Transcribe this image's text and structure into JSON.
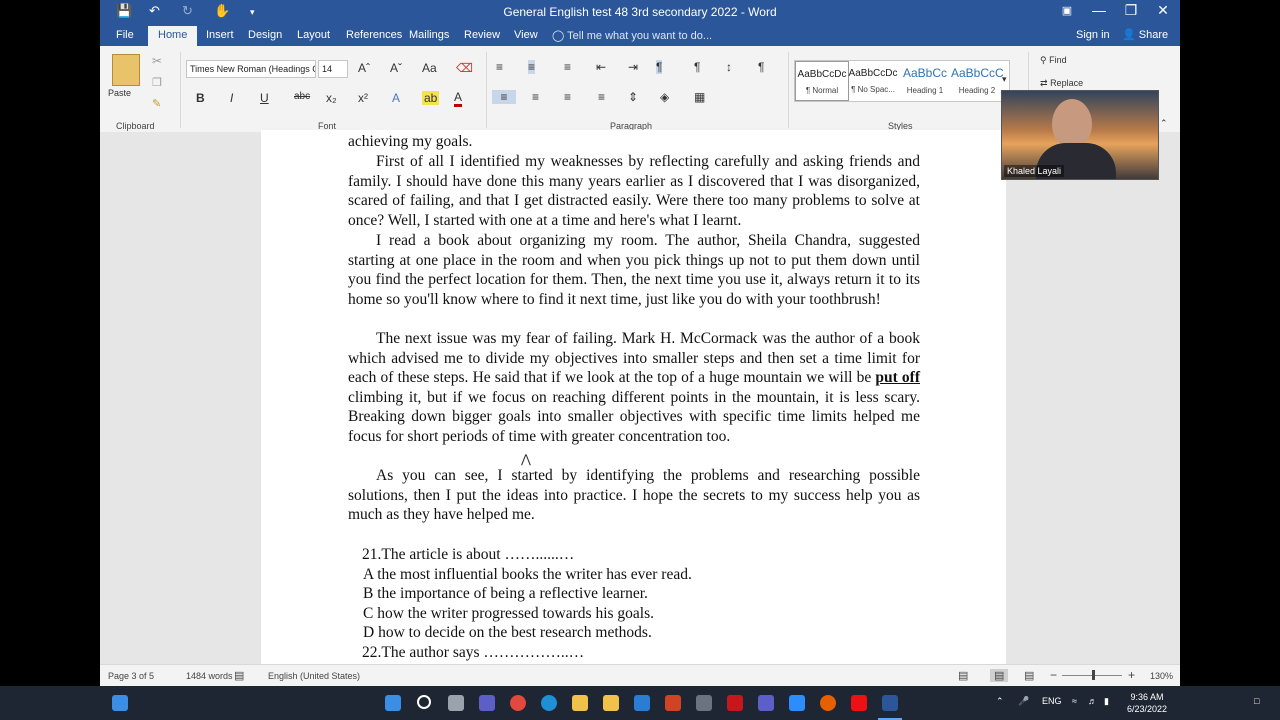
{
  "window": {
    "title": "General English test 48 3rd secondary 2022 - Word",
    "minimize": "—",
    "restore": "❐",
    "close": "✕",
    "ribbon_display_icon": "ribbon-display-icon"
  },
  "quick_access": {
    "save_icon": "save-icon",
    "undo_icon": "undo-icon",
    "redo_icon": "redo-icon",
    "touch_icon": "touch-mode-icon"
  },
  "tabs": [
    "File",
    "Home",
    "Insert",
    "Design",
    "Layout",
    "References",
    "Mailings",
    "Review",
    "View"
  ],
  "active_tab": "Home",
  "tell_me": "Tell me what you want to do...",
  "sign_in": "Sign in",
  "share": "Share",
  "ribbon": {
    "clipboard": {
      "label": "Clipboard",
      "paste": "Paste"
    },
    "font": {
      "label": "Font",
      "family": "Times New Roman (Headings C:",
      "size": "14"
    },
    "paragraph": {
      "label": "Paragraph"
    },
    "styles": {
      "label": "Styles",
      "items": [
        {
          "sample": "AaBbCcDc",
          "name": "¶ Normal"
        },
        {
          "sample": "AaBbCcDc",
          "name": "¶ No Spac..."
        },
        {
          "sample": "AaBbCc",
          "name": "Heading 1"
        },
        {
          "sample": "AaBbCcC",
          "name": "Heading 2"
        }
      ]
    },
    "editing": {
      "find": "Find",
      "replace": "Replace"
    }
  },
  "document": {
    "top_fragment": "achieving my goals.",
    "paragraphs": [
      "First of all I identified my weaknesses by reflecting carefully and asking friends and family. I should have done this many years earlier as I discovered that I was disorganized, scared of failing, and that I get distracted easily. Were there too many problems to solve at once? Well, I started with one at a time and here's what I learnt.",
      "I read a book about organizing my room. The author, Sheila Chandra, suggested starting at one place in the room and when you pick things up not to put them down until you find the perfect location for  them. Then, the next time you use it, always return it to its home so you'll know where to find it next  time, just like you do with your toothbrush!"
    ],
    "para3_before": "The next issue was my fear of failing. Mark H. McCormack was the author of a book which advised me  to divide my objectives into smaller steps and then set a time limit for each of these steps. He said that if we look at the top of a huge mountain we will be ",
    "para3_bold": "put off",
    "para3_after": " climbing it, but if we focus on reaching different points in the mountain, it is less scary. Breaking down bigger goals into smaller objectives with specific time limits helped me focus for short periods of time with greater concentration too.",
    "para4": "As you can see, I started by identifying the problems and researching possible solutions, then I put the  ideas into practice. I hope the secrets to my success help you as much as they have helped me.",
    "questions": [
      " 21.The article is about ……......…",
      "A the most influential books the writer has ever read.",
      "B the importance of being a reflective learner.",
      "C how the writer progressed towards his goals.",
      "D how to decide on the best research methods.",
      " 22.The author says ……………..…"
    ]
  },
  "status": {
    "page": "Page 3 of 5",
    "words": "1484 words",
    "language": "English (United States)",
    "zoom": "130%"
  },
  "video": {
    "name": "Khaled Layali"
  },
  "taskbar": {
    "lang": "ENG",
    "time": "9:36 AM",
    "date": "6/23/2022"
  }
}
